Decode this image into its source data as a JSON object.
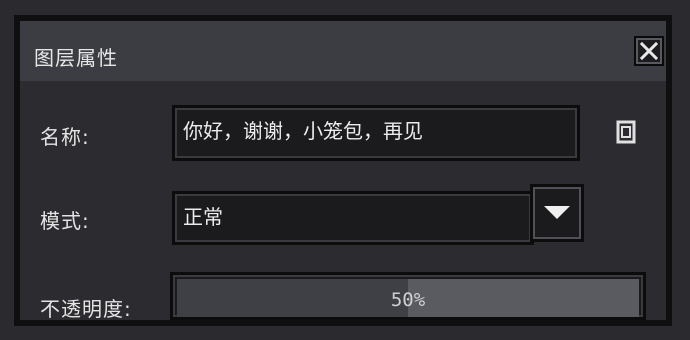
{
  "dialog": {
    "title": "图层属性",
    "close_icon": "close-icon"
  },
  "name_row": {
    "label": "名称:",
    "value": "你好，谢谢，小笼包，再见",
    "action_icon": "copy-icon"
  },
  "mode_row": {
    "label": "模式:",
    "selected": "正常",
    "dropdown_icon": "triangle-down-icon"
  },
  "opacity_row": {
    "label": "不透明度:",
    "value_text": "50%",
    "value": 0.5
  },
  "colors": {
    "titlebar": "#3c3d43",
    "background": "#2c2c30",
    "field": "#1b1b1e",
    "slider_fill": "#3f4046",
    "slider_track": "#5a5b61"
  }
}
